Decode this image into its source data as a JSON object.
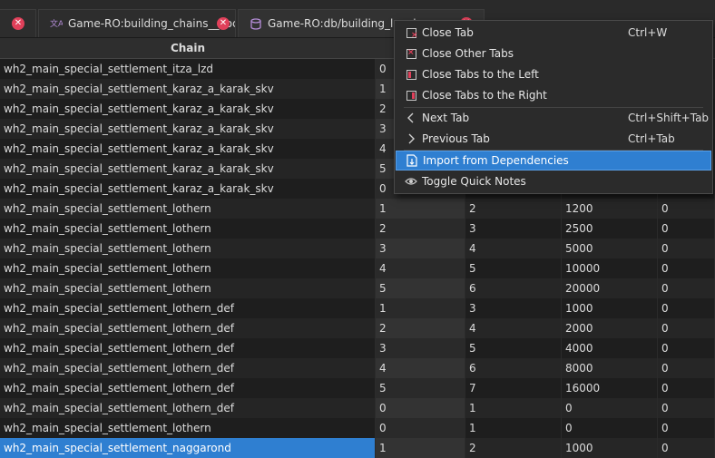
{
  "tabs": [
    {
      "label": "",
      "active": false
    },
    {
      "label": "Game-RO:building_chains__.loc",
      "active": false
    },
    {
      "label": "Game-RO:db/building_levels_",
      "active": true
    }
  ],
  "table": {
    "columns": [
      "Chain",
      "",
      "",
      "",
      ""
    ],
    "rows": [
      [
        "wh2_main_special_settlement_itza_lzd",
        "0",
        "",
        "",
        ""
      ],
      [
        "wh2_main_special_settlement_karaz_a_karak_skv",
        "1",
        "",
        "",
        ""
      ],
      [
        "wh2_main_special_settlement_karaz_a_karak_skv",
        "2",
        "",
        "",
        ""
      ],
      [
        "wh2_main_special_settlement_karaz_a_karak_skv",
        "3",
        "",
        "",
        ""
      ],
      [
        "wh2_main_special_settlement_karaz_a_karak_skv",
        "4",
        "",
        "",
        ""
      ],
      [
        "wh2_main_special_settlement_karaz_a_karak_skv",
        "5",
        "",
        "",
        ""
      ],
      [
        "wh2_main_special_settlement_karaz_a_karak_skv",
        "0",
        "",
        "",
        ""
      ],
      [
        "wh2_main_special_settlement_lothern",
        "1",
        "2",
        "1200",
        "0"
      ],
      [
        "wh2_main_special_settlement_lothern",
        "2",
        "3",
        "2500",
        "0"
      ],
      [
        "wh2_main_special_settlement_lothern",
        "3",
        "4",
        "5000",
        "0"
      ],
      [
        "wh2_main_special_settlement_lothern",
        "4",
        "5",
        "10000",
        "0"
      ],
      [
        "wh2_main_special_settlement_lothern",
        "5",
        "6",
        "20000",
        "0"
      ],
      [
        "wh2_main_special_settlement_lothern_def",
        "1",
        "3",
        "1000",
        "0"
      ],
      [
        "wh2_main_special_settlement_lothern_def",
        "2",
        "4",
        "2000",
        "0"
      ],
      [
        "wh2_main_special_settlement_lothern_def",
        "3",
        "5",
        "4000",
        "0"
      ],
      [
        "wh2_main_special_settlement_lothern_def",
        "4",
        "6",
        "8000",
        "0"
      ],
      [
        "wh2_main_special_settlement_lothern_def",
        "5",
        "7",
        "16000",
        "0"
      ],
      [
        "wh2_main_special_settlement_lothern_def",
        "0",
        "1",
        "0",
        "0"
      ],
      [
        "wh2_main_special_settlement_lothern",
        "0",
        "1",
        "0",
        "0"
      ],
      [
        "wh2_main_special_settlement_naggarond",
        "1",
        "2",
        "1000",
        "0"
      ]
    ],
    "selected_row": 19
  },
  "context_menu": {
    "items": [
      {
        "label": "Close Tab",
        "shortcut": "Ctrl+W",
        "icon": "close-tab-icon"
      },
      {
        "label": "Close Other Tabs",
        "shortcut": "",
        "icon": "close-other-tabs-icon"
      },
      {
        "label": "Close Tabs to the Left",
        "shortcut": "",
        "icon": "close-tabs-left-icon"
      },
      {
        "label": "Close Tabs to the Right",
        "shortcut": "",
        "icon": "close-tabs-right-icon"
      },
      {
        "label": "Next Tab",
        "shortcut": "Ctrl+Shift+Tab",
        "icon": "chevron-left-icon"
      },
      {
        "label": "Previous Tab",
        "shortcut": "Ctrl+Tab",
        "icon": "chevron-right-icon"
      },
      {
        "label": "Import from Dependencies",
        "shortcut": "",
        "icon": "import-file-icon",
        "highlighted": true
      },
      {
        "label": "Toggle Quick Notes",
        "shortcut": "",
        "icon": "eye-icon"
      }
    ]
  },
  "colors": {
    "accent": "#2f7fd1",
    "close_red": "#e0405a",
    "background": "#1e1e1e"
  }
}
